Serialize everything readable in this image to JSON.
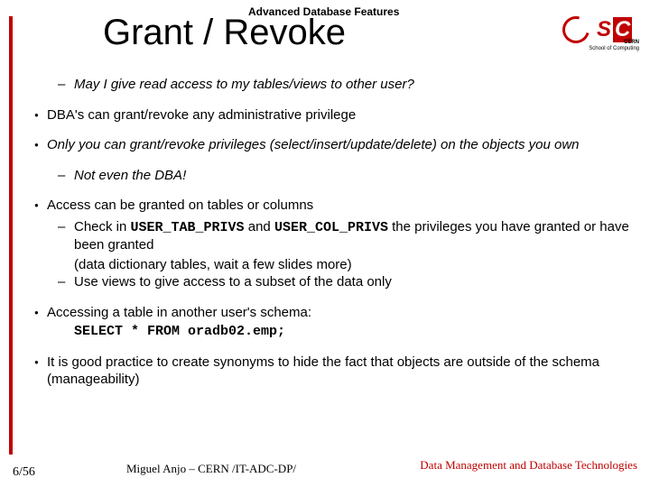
{
  "header": {
    "label": "Advanced Database Features",
    "title": "Grant / Revoke",
    "logo_cern": "CERN",
    "logo_school": "School of Computing"
  },
  "body": {
    "intro_q": "May I give read access to my tables/views to other user?",
    "b1": "DBA's can grant/revoke any administrative privilege",
    "b2": "Only you can grant/revoke privileges (select/insert/update/delete) on the objects you own",
    "b2_s1": "Not even the DBA!",
    "b3": "Access can be granted on tables or columns",
    "b3_s1_a": "Check in ",
    "b3_s1_code1": "USER_TAB_PRIVS",
    "b3_s1_b": " and ",
    "b3_s1_code2": "USER_COL_PRIVS",
    "b3_s1_c": " the privileges you have granted or have been granted",
    "b3_s1_d": "(data dictionary tables, wait a few slides more)",
    "b3_s2": "Use views to give access to a subset of the data only",
    "b4": "Accessing a table in another user's schema:",
    "b4_code": "SELECT * FROM oradb02.emp;",
    "b5": "It is good practice to create synonyms to hide the fact that objects are outside of the schema (manageability)"
  },
  "footer": {
    "page": "6/56",
    "author": "Miguel Anjo – CERN /IT-ADC-DP/",
    "right": "Data Management and Database Technologies"
  }
}
